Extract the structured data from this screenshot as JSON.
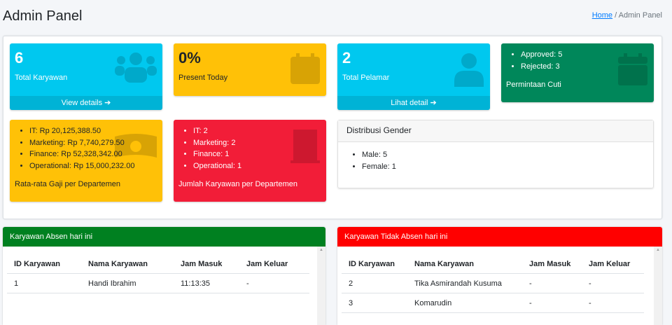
{
  "header": {
    "title": "Admin Panel",
    "breadcrumb": {
      "home": "Home",
      "separator": "/",
      "current": "Admin Panel"
    }
  },
  "cards": {
    "karyawan": {
      "value": "6",
      "label": "Total Karyawan",
      "link": "View details",
      "icon": "users-icon",
      "color": "#00c0ef"
    },
    "present": {
      "value": "0%",
      "label": "Present Today",
      "icon": "calendar-icon",
      "color": "#ffc107"
    },
    "pelamar": {
      "value": "2",
      "label": "Total Pelamar",
      "link": "Lihat detail",
      "icon": "user-tie-icon",
      "color": "#00c0ef"
    },
    "cuti": {
      "items": [
        "Approved: 5",
        "Rejected: 3"
      ],
      "label": "Permintaan Cuti",
      "icon": "calendar-alt-icon",
      "color": "#00875a"
    },
    "gaji": {
      "items": [
        "IT: Rp 20,125,388.50",
        "Marketing: Rp 7,740,279.50",
        "Finance: Rp 52,328,342.00",
        "Operational: Rp 15,000,232.00"
      ],
      "label": "Rata-rata Gaji per Departemen",
      "icon": "money-bill-icon",
      "color": "#ffc107"
    },
    "departemen": {
      "items": [
        "IT: 2",
        "Marketing: 2",
        "Finance: 1",
        "Operational: 1"
      ],
      "label": "Jumlah Karyawan per Departemen",
      "icon": "building-icon",
      "color": "#f21d38"
    }
  },
  "gender": {
    "title": "Distribusi Gender",
    "items": [
      "Male: 5",
      "Female: 1"
    ]
  },
  "absen": {
    "title": "Karyawan Absen hari ini",
    "color": "#008020",
    "columns": [
      "ID Karyawan",
      "Nama Karyawan",
      "Jam Masuk",
      "Jam Keluar"
    ],
    "rows": [
      [
        "1",
        "Handi Ibrahim",
        "11:13:35",
        "-"
      ]
    ]
  },
  "tidak_absen": {
    "title": "Karyawan Tidak Absen hari ini",
    "color": "#ff0000",
    "columns": [
      "ID Karyawan",
      "Nama Karyawan",
      "Jam Masuk",
      "Jam Keluar"
    ],
    "rows": [
      [
        "2",
        "Tika Asmirandah Kusuma",
        "-",
        "-"
      ],
      [
        "3",
        "Komarudin",
        "-",
        "-"
      ]
    ]
  }
}
